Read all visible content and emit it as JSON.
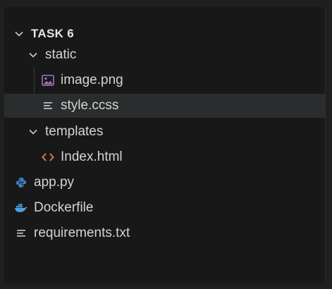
{
  "explorer": {
    "root": {
      "label": "TASK 6",
      "expanded": true
    },
    "items": [
      {
        "label": "static",
        "type": "folder",
        "expanded": true
      },
      {
        "label": "image.png",
        "type": "file",
        "icon": "image-icon"
      },
      {
        "label": "style.ccss",
        "type": "file",
        "icon": "text-lines-icon",
        "selected": true
      },
      {
        "label": "templates",
        "type": "folder",
        "expanded": true
      },
      {
        "label": "Index.html",
        "type": "file",
        "icon": "html-icon"
      },
      {
        "label": "app.py",
        "type": "file",
        "icon": "python-icon"
      },
      {
        "label": "Dockerfile",
        "type": "file",
        "icon": "docker-icon"
      },
      {
        "label": "requirements.txt",
        "type": "file",
        "icon": "text-lines-icon"
      }
    ]
  },
  "colors": {
    "background": "#181818",
    "selected_row": "#2a2d2e",
    "html_icon": "#e37933",
    "python_icon": "#3b82c4",
    "docker_icon": "#4aa1e0",
    "image_icon": "#a074c4"
  }
}
